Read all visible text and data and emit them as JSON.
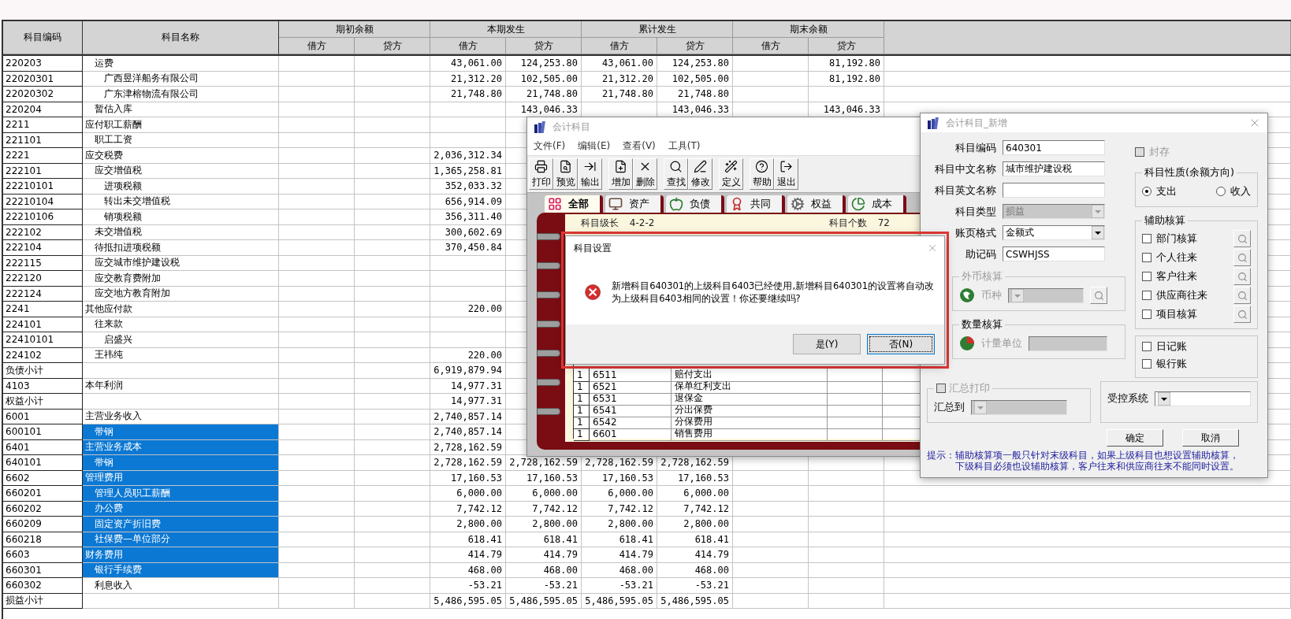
{
  "ledger": {
    "columns": [
      "科目编码",
      "科目名称"
    ],
    "groups": [
      {
        "label": "期初余额",
        "sub": [
          "借方",
          "贷方"
        ]
      },
      {
        "label": "本期发生",
        "sub": [
          "借方",
          "贷方"
        ]
      },
      {
        "label": "累计发生",
        "sub": [
          "借方",
          "贷方"
        ]
      },
      {
        "label": "期末余额",
        "sub": [
          "借方",
          "贷方"
        ]
      }
    ],
    "rows": [
      {
        "children": [
          {
            "code": "220203",
            "name": "运费",
            "selected": false,
            "values": {
              "period_debit": "43,061.00",
              "period_credit": "124,253.80",
              "cumulative_debit": "43,061.00",
              "cumulative_credit": "124,253.80",
              "closing_credit": "81,192.80"
            },
            "children": [
              {
                "code": "22020301",
                "name": "广西昱洋船务有限公司",
                "selected": false,
                "values": {
                  "period_debit": "21,312.20",
                  "period_credit": "102,505.00",
                  "cumulative_debit": "21,312.20",
                  "cumulative_credit": "102,505.00",
                  "closing_credit": "81,192.80"
                }
              },
              {
                "code": "22020302",
                "name": "广东津榕物流有限公司",
                "selected": false,
                "values": {
                  "period_debit": "21,748.80",
                  "period_credit": "21,748.80",
                  "cumulative_debit": "21,748.80",
                  "cumulative_credit": "21,748.80"
                }
              }
            ]
          },
          {
            "code": "220204",
            "name": "暂估入库",
            "selected": false,
            "values": {
              "period_credit": "143,046.33",
              "cumulative_credit": "143,046.33",
              "closing_credit": "143,046.33"
            }
          }
        ]
      },
      {
        "code": "2211",
        "name": "应付职工薪酬",
        "selected": false,
        "children": [
          {
            "code": "221101",
            "name": "职工工资",
            "selected": false
          }
        ]
      },
      {
        "code": "2221",
        "name": "应交税费",
        "selected": false,
        "values": {
          "period_debit": "2,036,312.34"
        },
        "children": [
          {
            "code": "222101",
            "name": "应交增值税",
            "selected": false,
            "values": {
              "period_debit": "1,365,258.81"
            },
            "children": [
              {
                "code": "22210101",
                "name": "进项税额",
                "selected": false,
                "values": {
                  "period_debit": "352,033.32"
                }
              },
              {
                "code": "22210104",
                "name": "转出未交增值税",
                "selected": false,
                "values": {
                  "period_debit": "656,914.09"
                }
              },
              {
                "code": "22210106",
                "name": "销项税额",
                "selected": false,
                "values": {
                  "period_debit": "356,311.40"
                }
              }
            ]
          },
          {
            "code": "222102",
            "name": "未交增值税",
            "selected": false,
            "values": {
              "period_debit": "300,602.69"
            }
          },
          {
            "code": "222104",
            "name": "待抵扣进项税额",
            "selected": false,
            "values": {
              "period_debit": "370,450.84"
            }
          },
          {
            "code": "222115",
            "name": "应交城市维护建设税",
            "selected": false
          },
          {
            "code": "222120",
            "name": "应交教育费附加",
            "selected": false
          },
          {
            "code": "222124",
            "name": "应交地方教育附加",
            "selected": false
          }
        ]
      },
      {
        "code": "2241",
        "name": "其他应付款",
        "selected": false,
        "values": {
          "period_debit": "220.00"
        },
        "children": [
          {
            "code": "224101",
            "name": "往来款",
            "selected": false,
            "children": [
              {
                "code": "22410101",
                "name": "启盛兴",
                "selected": false
              }
            ]
          },
          {
            "code": "224102",
            "name": "王祎纯",
            "selected": false,
            "values": {
              "period_debit": "220.00"
            }
          }
        ]
      },
      {
        "code": "负债小计",
        "selected": false,
        "values": {
          "period_debit": "6,919,879.94"
        }
      },
      {
        "code": "4103",
        "name": "本年利润",
        "selected": false,
        "values": {
          "period_debit": "14,977.31"
        }
      },
      {
        "code": "权益小计",
        "selected": false,
        "values": {
          "period_debit": "14,977.31"
        }
      },
      {
        "code": "6001",
        "name": "主营业务收入",
        "selected": false,
        "values": {
          "period_debit": "2,740,857.14"
        },
        "children": [
          {
            "code": "600101",
            "name": "带钢",
            "selected": true,
            "values": {
              "period_debit": "2,740,857.14"
            }
          }
        ]
      },
      {
        "code": "6401",
        "name": "主营业务成本",
        "selected": true,
        "values": {
          "period_debit": "2,728,162.59"
        },
        "children": [
          {
            "code": "640101",
            "name": "带钢",
            "selected": true,
            "values": {
              "period_debit": "2,728,162.59",
              "period_credit": "2,728,162.59",
              "cumulative_debit": "2,728,162.59",
              "cumulative_credit": "2,728,162.59"
            }
          }
        ]
      },
      {
        "code": "6602",
        "name": "管理费用",
        "selected": true,
        "values": {
          "period_debit": "17,160.53",
          "period_credit": "17,160.53",
          "cumulative_debit": "17,160.53",
          "cumulative_credit": "17,160.53"
        },
        "children": [
          {
            "code": "660201",
            "name": "管理人员职工薪酬",
            "selected": true,
            "values": {
              "period_debit": "6,000.00",
              "period_credit": "6,000.00",
              "cumulative_debit": "6,000.00",
              "cumulative_credit": "6,000.00"
            }
          },
          {
            "code": "660202",
            "name": "办公费",
            "selected": true,
            "values": {
              "period_debit": "7,742.12",
              "period_credit": "7,742.12",
              "cumulative_debit": "7,742.12",
              "cumulative_credit": "7,742.12"
            }
          },
          {
            "code": "660209",
            "name": "固定资产折旧费",
            "selected": true,
            "values": {
              "period_debit": "2,800.00",
              "period_credit": "2,800.00",
              "cumulative_debit": "2,800.00",
              "cumulative_credit": "2,800.00"
            }
          },
          {
            "code": "660218",
            "name": "社保费—单位部分",
            "selected": true,
            "values": {
              "period_debit": "618.41",
              "period_credit": "618.41",
              "cumulative_debit": "618.41",
              "cumulative_credit": "618.41"
            }
          }
        ]
      },
      {
        "code": "6603",
        "name": "财务费用",
        "selected": true,
        "values": {
          "period_debit": "414.79",
          "period_credit": "414.79",
          "cumulative_debit": "414.79",
          "cumulative_credit": "414.79"
        },
        "children": [
          {
            "code": "660301",
            "name": "银行手续费",
            "selected": true,
            "values": {
              "period_debit": "468.00",
              "period_credit": "468.00",
              "cumulative_debit": "468.00",
              "cumulative_credit": "468.00"
            }
          },
          {
            "code": "660302",
            "name": "利息收入",
            "selected": false,
            "values": {
              "period_debit": "-53.21",
              "period_credit": "-53.21",
              "cumulative_debit": "-53.21",
              "cumulative_credit": "-53.21"
            }
          }
        ]
      },
      {
        "code": "损益小计",
        "selected": false,
        "values": {
          "period_debit": "5,486,595.05",
          "period_credit": "5,486,595.05",
          "cumulative_debit": "5,486,595.05",
          "cumulative_credit": "5,486,595.05"
        }
      }
    ]
  },
  "accounts_window": {
    "title": "会计科目",
    "active": false,
    "menu": [
      "文件(F)",
      "编辑(E)",
      "查看(V)",
      "工具(T)"
    ],
    "toolbar": [
      [
        {
          "label": "打印",
          "kind": "print"
        },
        {
          "label": "预览",
          "kind": "preview"
        },
        {
          "label": "输出",
          "kind": "export"
        }
      ],
      [
        {
          "label": "增加",
          "kind": "add"
        },
        {
          "label": "删除",
          "kind": "delete"
        }
      ],
      [
        {
          "label": "查找",
          "kind": "find"
        },
        {
          "label": "修改",
          "kind": "edit"
        }
      ],
      [
        {
          "label": "定义",
          "kind": "define"
        }
      ],
      [
        {
          "label": "帮助",
          "kind": "help"
        },
        {
          "label": "退出",
          "kind": "exit"
        }
      ]
    ],
    "tabs": [
      {
        "label": "全部",
        "kind": "all",
        "selected": true
      },
      {
        "label": "资产",
        "kind": "assets",
        "selected": false
      },
      {
        "label": "负债",
        "kind": "liabilities",
        "selected": false
      },
      {
        "label": "共同",
        "kind": "common",
        "selected": false
      },
      {
        "label": "权益",
        "kind": "equity",
        "selected": false
      },
      {
        "label": "成本",
        "kind": "cost",
        "selected": false
      }
    ],
    "grade_label": "科目级长",
    "grade_value": "4-2-2",
    "count_label": "科目个数",
    "count_value": "72",
    "grid_rows": [
      {
        "grade": "1",
        "code": "6511",
        "name": "赔付支出"
      },
      {
        "grade": "1",
        "code": "6521",
        "name": "保单红利支出"
      },
      {
        "grade": "1",
        "code": "6531",
        "name": "退保金"
      },
      {
        "grade": "1",
        "code": "6541",
        "name": "分出保费"
      },
      {
        "grade": "1",
        "code": "6542",
        "name": "分保费用"
      },
      {
        "grade": "1",
        "code": "6601",
        "name": "销售费用"
      }
    ]
  },
  "new_account_window": {
    "title": "会计科目_新增",
    "active": false,
    "fields": [
      {
        "label": "科目编码",
        "kind": "input",
        "value": "640301",
        "disabled": false
      },
      {
        "label": "科目中文名称",
        "kind": "input",
        "value": "城市维护建设税",
        "disabled": false
      },
      {
        "label": "科目英文名称",
        "kind": "input",
        "disabled": false
      },
      {
        "label": "科目类型",
        "kind": "select",
        "value": "损益",
        "disabled": true
      },
      {
        "label": "账页格式",
        "kind": "select",
        "value": "金额式",
        "disabled": false
      },
      {
        "label": "助记码",
        "kind": "input",
        "value": "CSWHJSS",
        "disabled": false
      }
    ],
    "currency_group": {
      "title": "外币核算",
      "label": "币种",
      "disabled": true
    },
    "quantity_group": {
      "title": "数量核算",
      "label": "计量单位",
      "disabled": true
    },
    "summary_group": {
      "title": "汇总打印",
      "checked": false,
      "disabled": true,
      "label": "汇总到"
    },
    "sealed": {
      "label": "封存",
      "checked": false,
      "disabled": true
    },
    "balance_direction": {
      "title": "科目性质(余额方向)",
      "options": [
        {
          "label": "支出",
          "selected": true
        },
        {
          "label": "收入",
          "selected": false
        }
      ]
    },
    "auxiliary": {
      "title": "辅助核算",
      "items": [
        {
          "label": "部门核算",
          "checked": false
        },
        {
          "label": "个人往来",
          "checked": false
        },
        {
          "label": "客户往来",
          "checked": false
        },
        {
          "label": "供应商往来",
          "checked": false
        },
        {
          "label": "项目核算",
          "checked": false
        }
      ]
    },
    "books": [
      {
        "label": "日记账",
        "checked": false
      },
      {
        "label": "银行账",
        "checked": false
      }
    ],
    "controlled_system": {
      "label": "受控系统"
    },
    "buttons": [
      "确定",
      "取消"
    ],
    "hint_lines": [
      "提示：辅助核算项一般只针对末级科目，如果上级科目也想设置辅助核算，",
      "下级科目必须也设辅助核算，客户往来和供应商往来不能同时设置。"
    ]
  },
  "confirm_dialog": {
    "title": "科目设置",
    "active": true,
    "highlighted": true,
    "message": "新增科目640301的上级科目6403已经使用,新增科目640301的设置将自动改为上级科目6403相同的设置！你还要继续吗?",
    "buttons": [
      {
        "label": "是(Y)",
        "focused": false
      },
      {
        "label": "否(N)",
        "focused": true
      }
    ]
  }
}
